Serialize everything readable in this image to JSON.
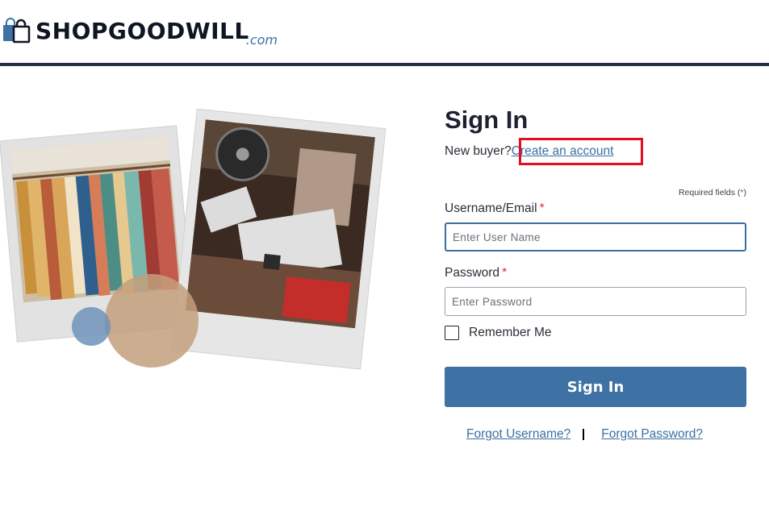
{
  "header": {
    "logo_text": "SHOPGOODWILL",
    "logo_suffix": ".com",
    "logo_icon": "shopping-bag-icon"
  },
  "colors": {
    "accent": "#3e71a4",
    "header_rule": "#243145",
    "highlight": "#e0101e",
    "required": "#d63434"
  },
  "hero": {
    "images": [
      "clothing-rack-photo",
      "vinyl-records-photo"
    ]
  },
  "signin": {
    "title": "Sign In",
    "new_buyer_text": "New buyer?",
    "create_account_link": "Create an account",
    "required_note_text": "Required fields (",
    "required_note_star": "*",
    "required_note_close": ")",
    "username_label": "Username/Email",
    "username_required": "*",
    "username_placeholder": "Enter User Name",
    "password_label": "Password",
    "password_required": "*",
    "password_placeholder": "Enter Password",
    "remember_label": "Remember Me",
    "submit_label": "Sign In",
    "forgot_username": "Forgot Username?",
    "forgot_password": "Forgot Password?"
  }
}
